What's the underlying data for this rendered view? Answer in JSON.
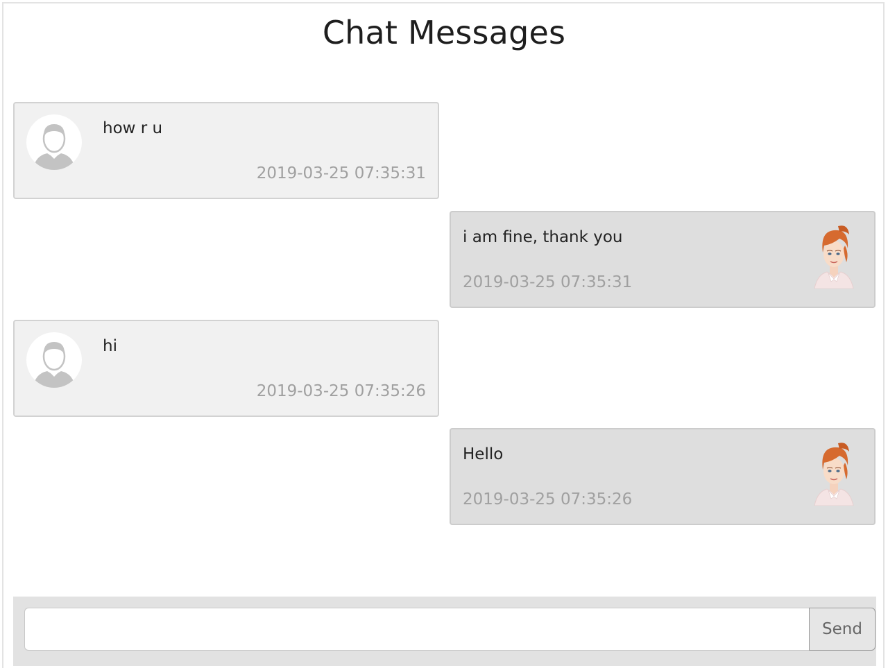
{
  "header": {
    "title": "Chat Messages"
  },
  "messages": [
    {
      "side": "left",
      "avatar": "male-user-placeholder-icon",
      "text": "how r u",
      "timestamp": "2019-03-25 07:35:31"
    },
    {
      "side": "right",
      "avatar": "red-haired-woman-avatar",
      "text": "i am fine, thank you",
      "timestamp": "2019-03-25 07:35:31"
    },
    {
      "side": "left",
      "avatar": "male-user-placeholder-icon",
      "text": "hi",
      "timestamp": "2019-03-25 07:35:26"
    },
    {
      "side": "right",
      "avatar": "red-haired-woman-avatar",
      "text": "Hello",
      "timestamp": "2019-03-25 07:35:26"
    }
  ],
  "composer": {
    "input_value": "",
    "input_placeholder": "",
    "send_label": "Send"
  },
  "colors": {
    "incoming_bubble": "#f1f1f1",
    "outgoing_bubble": "#dedede",
    "timestamp": "#a0a0a0",
    "composer_bar": "#e2e2e2"
  }
}
